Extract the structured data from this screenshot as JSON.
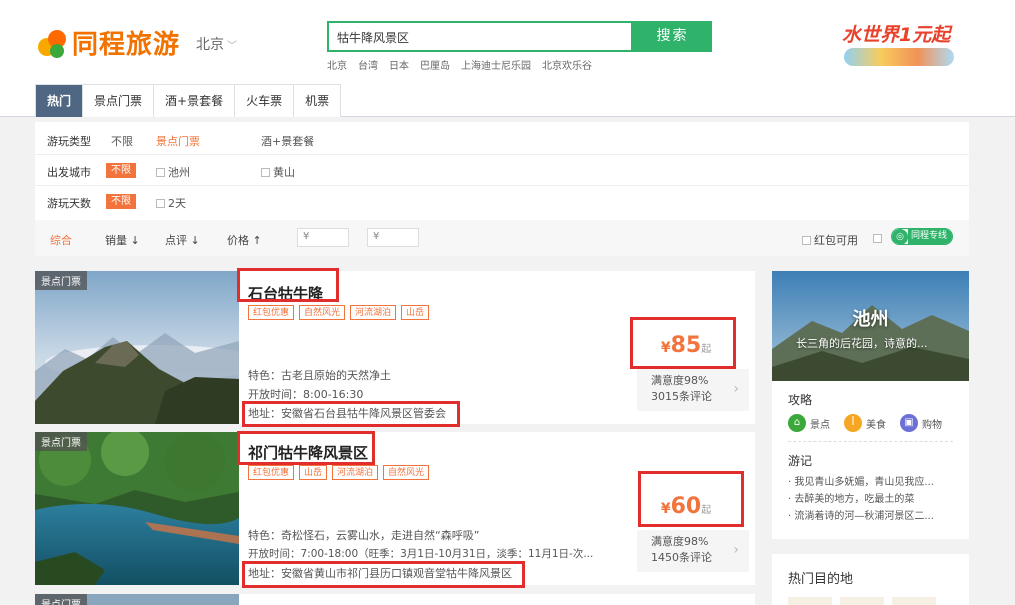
{
  "header": {
    "logo_text": "同程旅游",
    "city": "北京",
    "search_value": "牯牛降风景区",
    "search_button": "搜索",
    "hot_links": [
      "北京",
      "台湾",
      "日本",
      "巴厘岛",
      "上海迪士尼乐园",
      "北京欢乐谷"
    ],
    "promo_text": "水世界1元起"
  },
  "tabs": [
    {
      "label": "热门",
      "active": true
    },
    {
      "label": "景点门票",
      "active": false
    },
    {
      "label": "酒+景套餐",
      "active": false
    },
    {
      "label": "火车票",
      "active": false
    },
    {
      "label": "机票",
      "active": false
    }
  ],
  "filters": {
    "type": {
      "label": "游玩类型",
      "options": [
        "不限",
        "景点门票",
        "酒+景套餐"
      ]
    },
    "city": {
      "label": "出发城市",
      "selected": "不限",
      "options": [
        "池州",
        "黄山"
      ]
    },
    "days": {
      "label": "游玩天数",
      "selected": "不限",
      "options": [
        "2天"
      ]
    }
  },
  "sort": {
    "items": [
      "综合",
      "销量",
      "点评",
      "价格"
    ],
    "price_placeholder": "¥",
    "price_separator": "-",
    "hongbao": "红包可用",
    "tongcheng_badge": "同程专线",
    "tongcheng_symbol": "◎"
  },
  "listings": [
    {
      "image_label": "景点门票",
      "title": "石台牯牛降",
      "tags": [
        "红包优惠",
        "自然风光",
        "河流湖泊",
        "山岳"
      ],
      "feature": "特色：古老且原始的天然净土",
      "hours": "开放时间：8:00-16:30",
      "address": "地址：安徽省石台县牯牛降风景区管委会",
      "currency": "¥",
      "price": "85",
      "price_unit": "起",
      "satisfaction": "满意度98%",
      "reviews": "3015条评论"
    },
    {
      "image_label": "景点门票",
      "title": "祁门牯牛降风景区",
      "tags": [
        "红包优惠",
        "山岳",
        "河流湖泊",
        "自然风光"
      ],
      "feature": "特色：奇松怪石，云雾山水，走进自然“森呼吸”",
      "hours": "开放时间：7:00-18:00（旺季：3月1日-10月31日，淡季：11月1日-次...",
      "address": "地址：安徽省黄山市祁门县历口镇观音堂牯牛降风景区",
      "currency": "¥",
      "price": "60",
      "price_unit": "起",
      "satisfaction": "满意度98%",
      "reviews": "1450条评论"
    },
    {
      "image_label": "景点门票"
    }
  ],
  "sidebar": {
    "city": "池州",
    "slogan": "长三角的后花园，诗意的...",
    "guide_title": "攻略",
    "guide_items": [
      {
        "label": "景点",
        "color": "#3aa83a",
        "icon": "house-icon"
      },
      {
        "label": "美食",
        "color": "#f5a623",
        "icon": "food-icon"
      },
      {
        "label": "购物",
        "color": "#6b6fd6",
        "icon": "bag-icon"
      }
    ],
    "notes_title": "游记",
    "notes": [
      "· 我见青山多妩媚，青山见我应...",
      "· 去醉美的地方，吃最土的菜",
      "· 流淌着诗的河—秋浦河景区二..."
    ],
    "hot_destinations": "热门目的地"
  },
  "colors": {
    "brand_orange": "#f2733b",
    "search_green": "#2fb36a",
    "active_tab": "#4f6782",
    "highlight_red": "#e22d2d"
  }
}
